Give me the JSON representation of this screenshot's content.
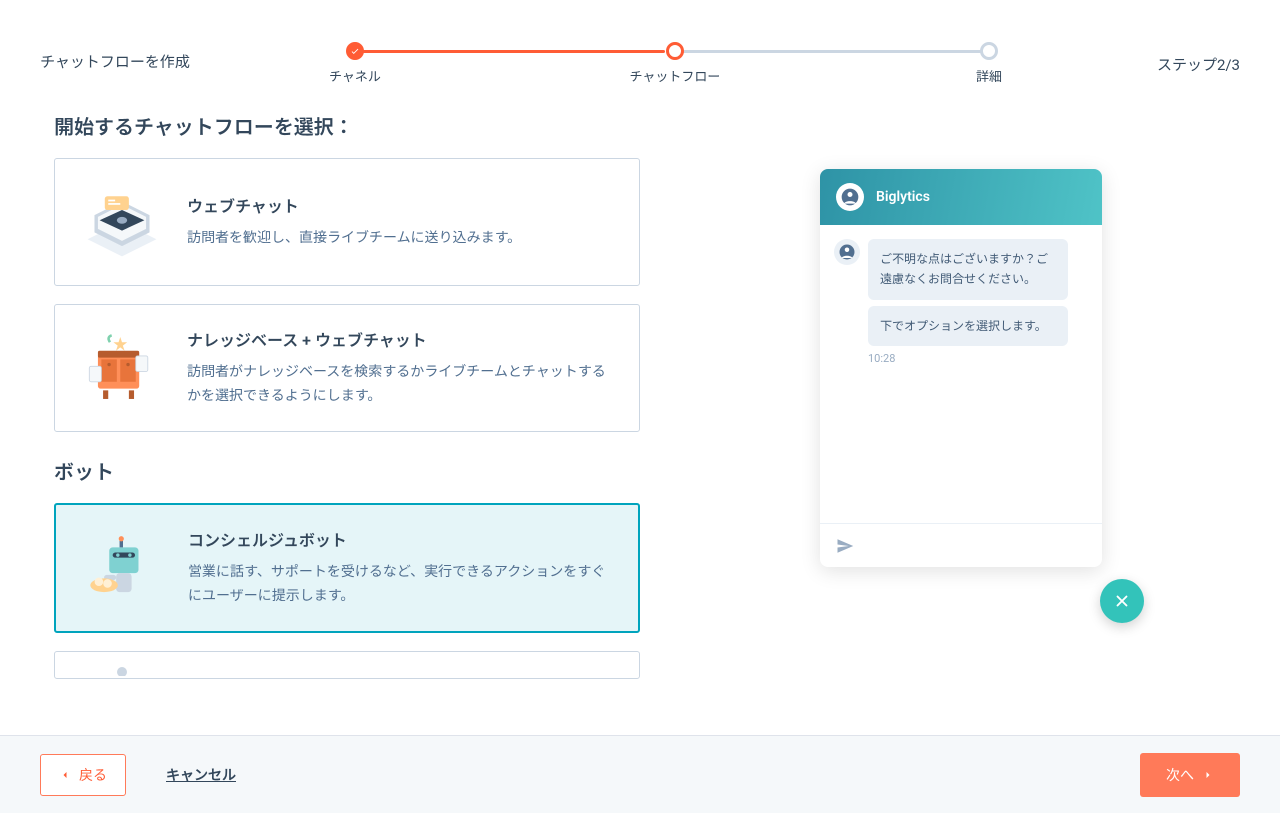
{
  "header": {
    "title": "チャットフローを作成",
    "step_indicator": "ステップ2/3",
    "steps": {
      "channel": "チャネル",
      "chatflow": "チャットフロー",
      "details": "詳細"
    }
  },
  "sections": {
    "select_title": "開始するチャットフローを選択：",
    "bot_heading": "ボット"
  },
  "cards": {
    "webchat": {
      "title": "ウェブチャット",
      "desc": "訪問者を歓迎し、直接ライブチームに送り込みます。"
    },
    "kb_webchat": {
      "title": "ナレッジベース + ウェブチャット",
      "desc": "訪問者がナレッジベースを検索するかライブチームとチャットするかを選択できるようにします。"
    },
    "concierge": {
      "title": "コンシェルジュボット",
      "desc": "営業に話す、サポートを受けるなど、実行できるアクションをすぐにユーザーに提示します。"
    }
  },
  "preview": {
    "brand": "Biglytics",
    "msg1": "ご不明な点はございますか？ご遠慮なくお問合せください。",
    "msg2": "下でオプションを選択します。",
    "time": "10:28"
  },
  "footer": {
    "back": "戻る",
    "cancel": "キャンセル",
    "next": "次へ"
  }
}
